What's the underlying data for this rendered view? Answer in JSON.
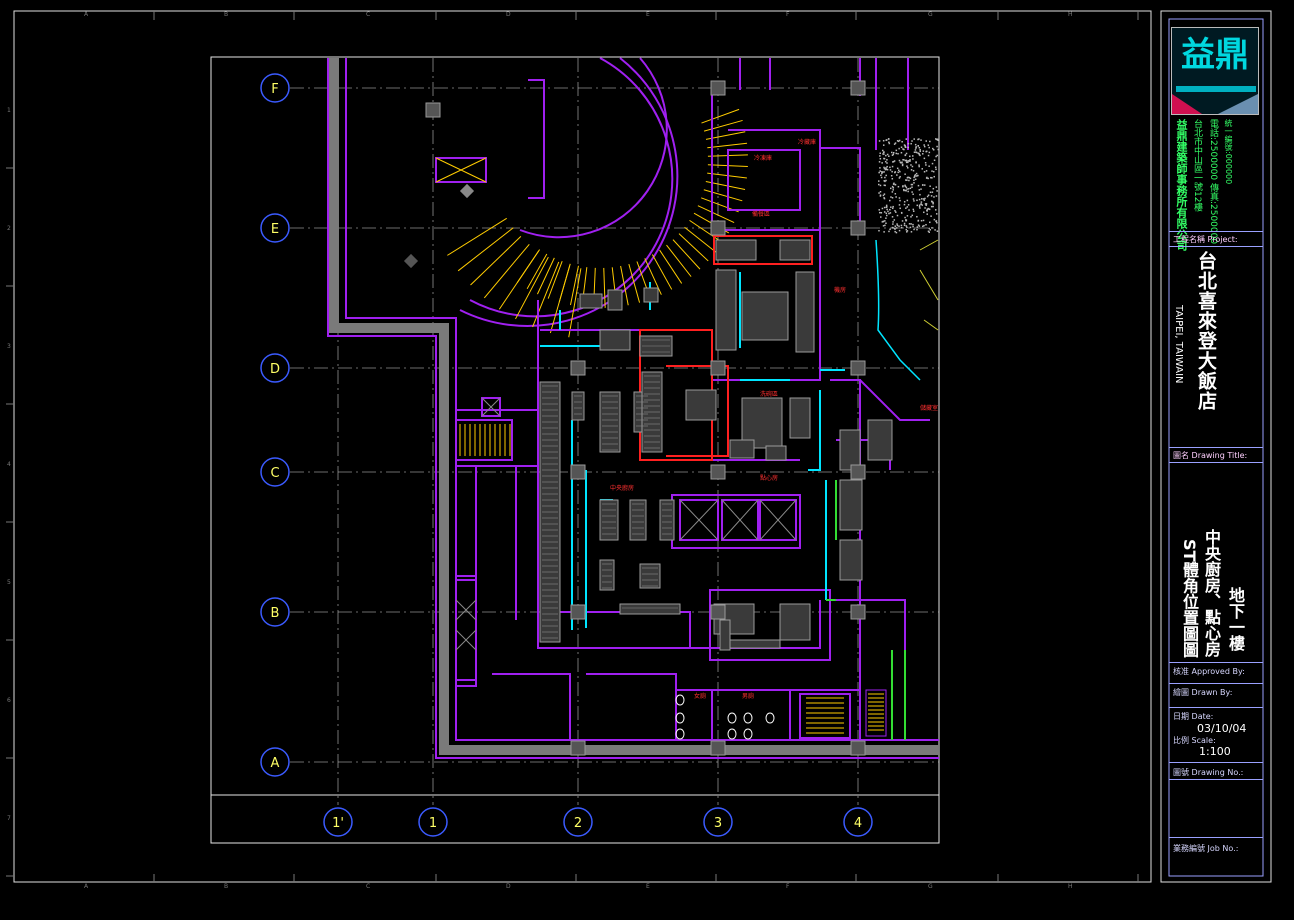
{
  "sheet": {
    "frame_col_letters": [
      "A",
      "B",
      "C",
      "D",
      "E",
      "F",
      "G",
      "H"
    ],
    "frame_row_numbers": [
      "1",
      "2",
      "3",
      "4",
      "5",
      "6",
      "7"
    ]
  },
  "plan": {
    "row_bubbles": [
      "F",
      "E",
      "D",
      "C",
      "B",
      "A"
    ],
    "col_bubbles": [
      "1'",
      "1",
      "2",
      "3",
      "4"
    ],
    "room_labels": [
      "中央廚房",
      "點心房",
      "冷藏庫",
      "冷凍庫",
      "機房",
      "洗碗區",
      "備餐區",
      "男廁",
      "女廁",
      "儲藏室"
    ]
  },
  "title_block": {
    "company_name": "益鼎建築師事務所有限公司",
    "company_addr": "台北市中山區一號12樓",
    "company_tel": "電話:2500000 傳真:2500000",
    "company_extra": "統一編號:000000",
    "project_heading": "工程名稱 Project:",
    "project_name": "台北喜來登大飯店",
    "project_en": "TAIPEI, TAIWAIN",
    "drawing_title_heading": "圖名 Drawing Title:",
    "drawing_title_line1": "地下一樓",
    "drawing_title_line2": "中央廚房、點心房",
    "drawing_title_line3": "ST體角位置圖圖",
    "approved_label": "核准 Approved By:",
    "drawn_label": "繪圖 Drawn By:",
    "date_label": "日期 Date:",
    "date_value": "03/10/04",
    "scale_label": "比例 Scale:",
    "scale_value": "1:100",
    "drawing_no_label": "圖號 Drawing No.:",
    "job_no_label": "業務編號 Job No.:"
  },
  "colors": {
    "wall": "#a020f0",
    "grid": "#cfcfcf",
    "bubble": "#3b5bff",
    "cyan": "#00e5ff",
    "red": "#ff2020",
    "yellow": "#ffcc00",
    "frame": "#e0e0e0"
  }
}
